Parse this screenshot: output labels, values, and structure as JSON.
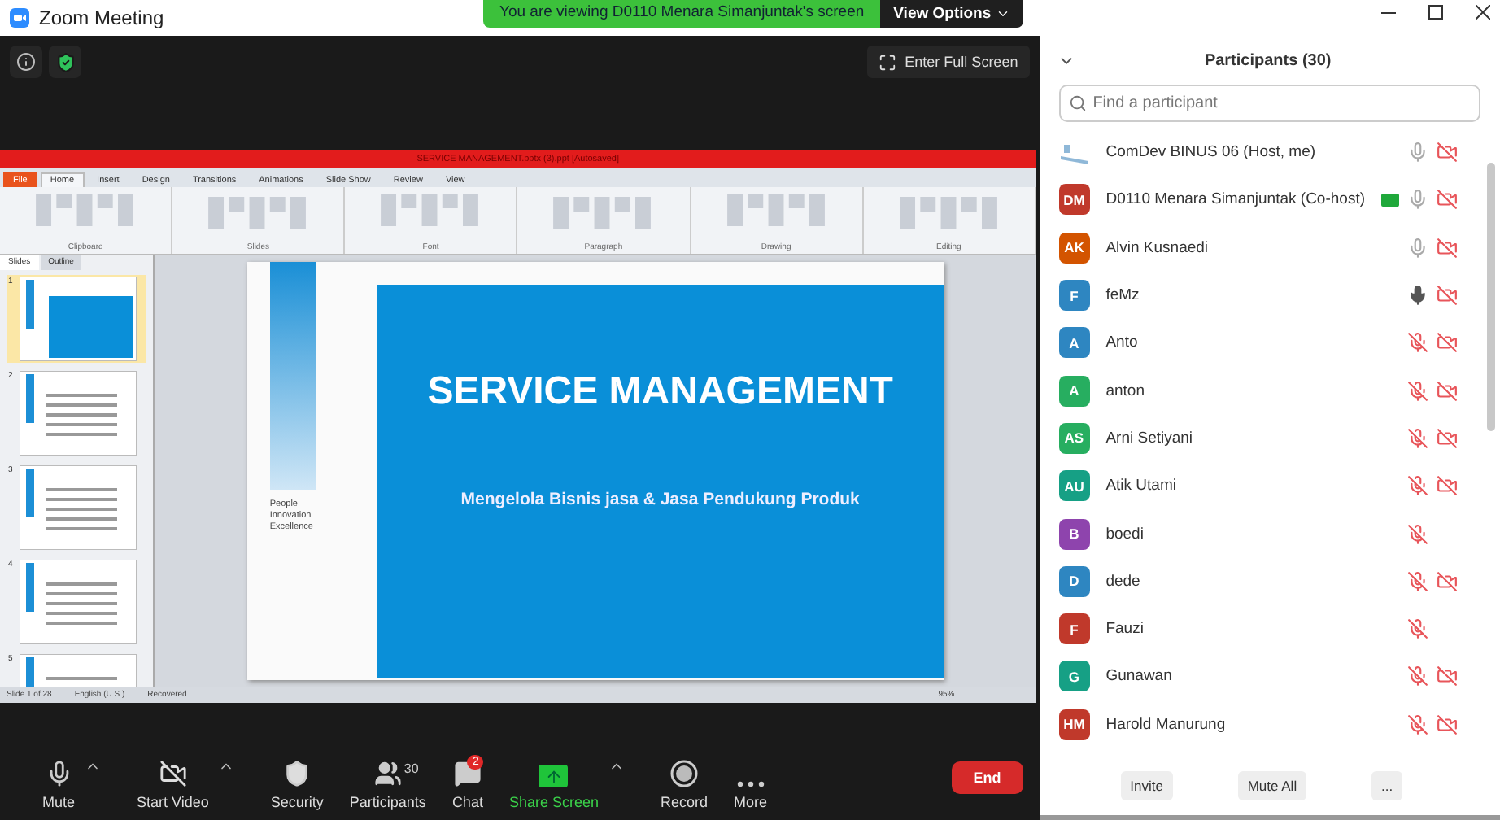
{
  "window": {
    "title": "Zoom Meeting"
  },
  "share_banner": {
    "text": "You are viewing D0110 Menara Simanjuntak's screen",
    "button": "View Options"
  },
  "top_bar": {
    "fullscreen_button": "Enter Full Screen"
  },
  "shared_screen": {
    "title": "SERVICE MANAGEMENT.pptx (3).ppt [Autosaved]",
    "tabs": [
      {
        "label": "File",
        "selected": false,
        "kind": "file"
      },
      {
        "label": "Home",
        "selected": true,
        "kind": "tab"
      },
      {
        "label": "Insert",
        "selected": false,
        "kind": "tab"
      },
      {
        "label": "Design",
        "selected": false,
        "kind": "tab"
      },
      {
        "label": "Transitions",
        "selected": false,
        "kind": "tab"
      },
      {
        "label": "Animations",
        "selected": false,
        "kind": "tab"
      },
      {
        "label": "Slide Show",
        "selected": false,
        "kind": "tab"
      },
      {
        "label": "Review",
        "selected": false,
        "kind": "tab"
      },
      {
        "label": "View",
        "selected": false,
        "kind": "tab"
      }
    ],
    "ribbon_groups": [
      "Clipboard",
      "Slides",
      "Font",
      "Paragraph",
      "Drawing",
      "Editing"
    ],
    "pane_tabs": [
      {
        "label": "Slides",
        "selected": true
      },
      {
        "label": "Outline",
        "selected": false
      }
    ],
    "thumbnails": [
      {
        "number": "1",
        "selected": true
      },
      {
        "number": "2",
        "selected": false
      },
      {
        "number": "3",
        "selected": false
      },
      {
        "number": "4",
        "selected": false
      },
      {
        "number": "5",
        "selected": false
      }
    ],
    "slide": {
      "side_text": [
        "People",
        "Innovation",
        "Excellence"
      ],
      "title": "SERVICE MANAGEMENT",
      "subtitle": "Mengelola Bisnis jasa & Jasa Pendukung Produk"
    },
    "status_bar": {
      "slide": "Slide 1 of 28",
      "language": "English (U.S.)",
      "state": "Recovered",
      "zoom": "95%"
    }
  },
  "participants": {
    "title": "Participants (30)",
    "search": {
      "placeholder": "Find a participant"
    },
    "rows": [
      {
        "name": "ComDev BINUS 06 (Host, me)",
        "kind": "image",
        "color": "#8fb8d8",
        "sharing": false,
        "muted": false,
        "speaking": false,
        "video_off": true
      },
      {
        "name": "D0110 Menara Simanjuntak (Co-host)",
        "kind": "initials",
        "initials": "DM",
        "color": "#c0392b",
        "sharing": true,
        "muted": false,
        "speaking": false,
        "video_off": true
      },
      {
        "name": "Alvin Kusnaedi",
        "kind": "initials",
        "initials": "AK",
        "color": "#d35400",
        "sharing": false,
        "muted": false,
        "speaking": false,
        "video_off": true
      },
      {
        "name": "feMz",
        "kind": "initials",
        "initials": "F",
        "color": "#2e86c1",
        "sharing": false,
        "muted": false,
        "speaking": true,
        "video_off": true
      },
      {
        "name": "Anto",
        "kind": "initials",
        "initials": "A",
        "color": "#2e86c1",
        "sharing": false,
        "muted": true,
        "video_off": true
      },
      {
        "name": "anton",
        "kind": "initials",
        "initials": "A",
        "color": "#27ae60",
        "sharing": false,
        "muted": true,
        "video_off": true
      },
      {
        "name": "Arni Setiyani",
        "kind": "initials",
        "initials": "AS",
        "color": "#27ae60",
        "sharing": false,
        "muted": true,
        "video_off": true
      },
      {
        "name": "Atik Utami",
        "kind": "initials",
        "initials": "AU",
        "color": "#16a085",
        "sharing": false,
        "muted": true,
        "video_off": true
      },
      {
        "name": "boedi",
        "kind": "initials",
        "initials": "B",
        "color": "#8e44ad",
        "sharing": false,
        "muted": true,
        "video_off": false
      },
      {
        "name": "dede",
        "kind": "initials",
        "initials": "D",
        "color": "#2e86c1",
        "sharing": false,
        "muted": true,
        "video_off": true
      },
      {
        "name": "Fauzi",
        "kind": "initials",
        "initials": "F",
        "color": "#c0392b",
        "sharing": false,
        "muted": true,
        "video_off": false
      },
      {
        "name": "Gunawan",
        "kind": "initials",
        "initials": "G",
        "color": "#16a085",
        "sharing": false,
        "muted": true,
        "video_off": true
      },
      {
        "name": "Harold Manurung",
        "kind": "initials",
        "initials": "HM",
        "color": "#c0392b",
        "sharing": false,
        "muted": true,
        "video_off": true
      }
    ],
    "buttons": [
      "Invite",
      "Mute All",
      "..."
    ]
  },
  "toolbar": [
    {
      "kind": "mute",
      "label": "Mute",
      "caret": true
    },
    {
      "kind": "video",
      "label": "Start Video",
      "caret": true
    },
    {
      "kind": "security",
      "label": "Security",
      "caret": false
    },
    {
      "kind": "participants",
      "label": "Participants",
      "count": "30",
      "caret": false
    },
    {
      "kind": "chat",
      "label": "Chat",
      "badge": "2",
      "caret": false
    },
    {
      "kind": "share",
      "label": "Share Screen",
      "caret": true
    },
    {
      "kind": "record",
      "label": "Record",
      "caret": false
    },
    {
      "kind": "more",
      "label": "More",
      "caret": false
    }
  ],
  "end_button": "End"
}
